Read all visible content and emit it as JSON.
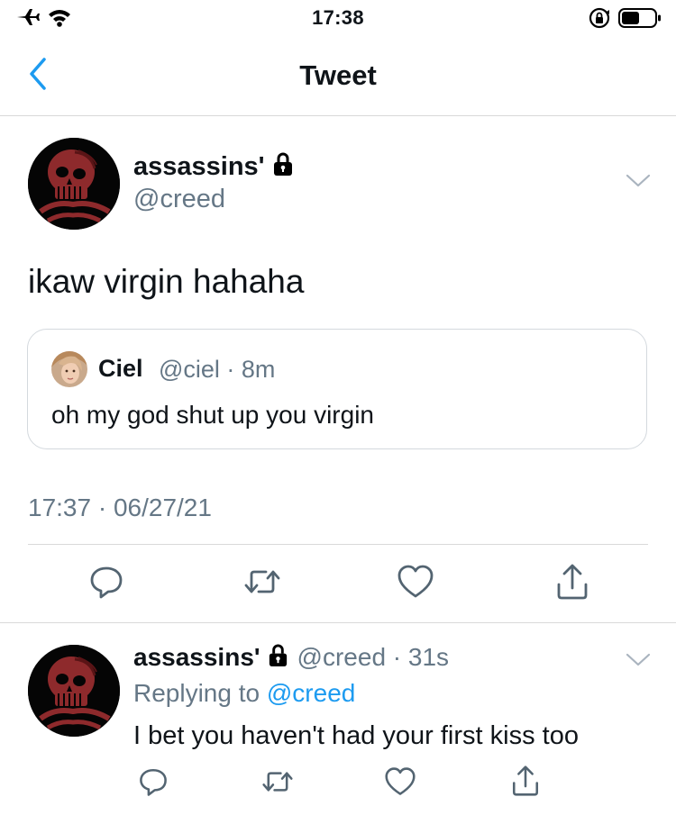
{
  "status_bar": {
    "time": "17:38",
    "icons": [
      "airplane-icon",
      "wifi-icon",
      "orientation-lock-icon",
      "battery-icon"
    ]
  },
  "nav": {
    "title": "Tweet",
    "back_icon": "chevron-left-icon"
  },
  "main_tweet": {
    "display_name": "assassins'",
    "handle": "@creed",
    "text": "ikaw virgin hahaha",
    "quoted": {
      "display_name": "Ciel",
      "meta": "@ciel · 8m",
      "text": "oh my god shut up you virgin"
    },
    "timestamp": "17:37 · 06/27/21",
    "actions": [
      "reply-icon",
      "retweet-icon",
      "like-icon",
      "share-icon"
    ]
  },
  "reply_tweet": {
    "display_name": "assassins'",
    "meta": "@creed · 31s",
    "replying_prefix": "Replying to",
    "replying_handle": "@creed",
    "text": "I bet you haven't had your first kiss too",
    "actions": [
      "reply-icon",
      "retweet-icon",
      "like-icon",
      "share-icon"
    ]
  },
  "colors": {
    "accent": "#1d9bf0",
    "text": "#0f1419",
    "secondary": "#657786",
    "divider": "#d9d9d9",
    "avatar_red": "#8e2a2c"
  }
}
